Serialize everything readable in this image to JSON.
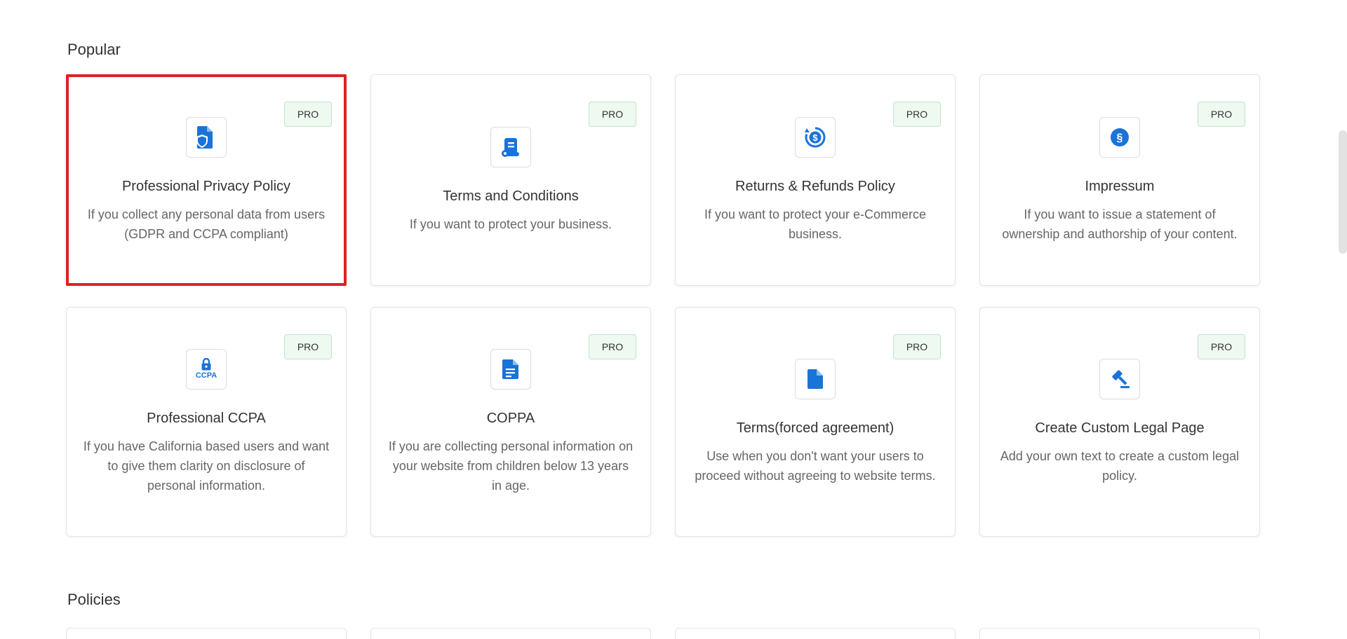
{
  "sections": {
    "popular_title": "Popular",
    "policies_title": "Policies"
  },
  "badge_label": "PRO",
  "cards": [
    {
      "title": "Professional Privacy Policy",
      "desc": "If you collect any personal data from users (GDPR and CCPA compliant)",
      "icon": "privacy-policy-icon",
      "selected": true
    },
    {
      "title": "Terms and Conditions",
      "desc": "If you want to protect your business.",
      "icon": "scroll-icon"
    },
    {
      "title": "Returns & Refunds Policy",
      "desc": "If you want to protect your e-Commerce business.",
      "icon": "refund-icon"
    },
    {
      "title": "Impressum",
      "desc": "If you want to issue a statement of ownership and authorship of your content.",
      "icon": "section-sign-icon"
    },
    {
      "title": "Professional CCPA",
      "desc": "If you have California based users and want to give them clarity on disclosure of personal information.",
      "icon": "ccpa-lock-icon",
      "icon_text": "CCPA"
    },
    {
      "title": "COPPA",
      "desc": "If you are collecting personal information on your website from children below 13 years in age.",
      "icon": "document-icon"
    },
    {
      "title": "Terms(forced agreement)",
      "desc": "Use when you don't want your users to proceed without agreeing to website terms.",
      "icon": "file-icon"
    },
    {
      "title": "Create Custom Legal Page",
      "desc": "Add your own text to create a custom legal policy.",
      "icon": "gavel-icon"
    }
  ],
  "colors": {
    "accent": "#1a73d9",
    "selected_border": "#e02020",
    "badge_bg": "#eef9f0",
    "badge_border": "#bfe5c7"
  }
}
